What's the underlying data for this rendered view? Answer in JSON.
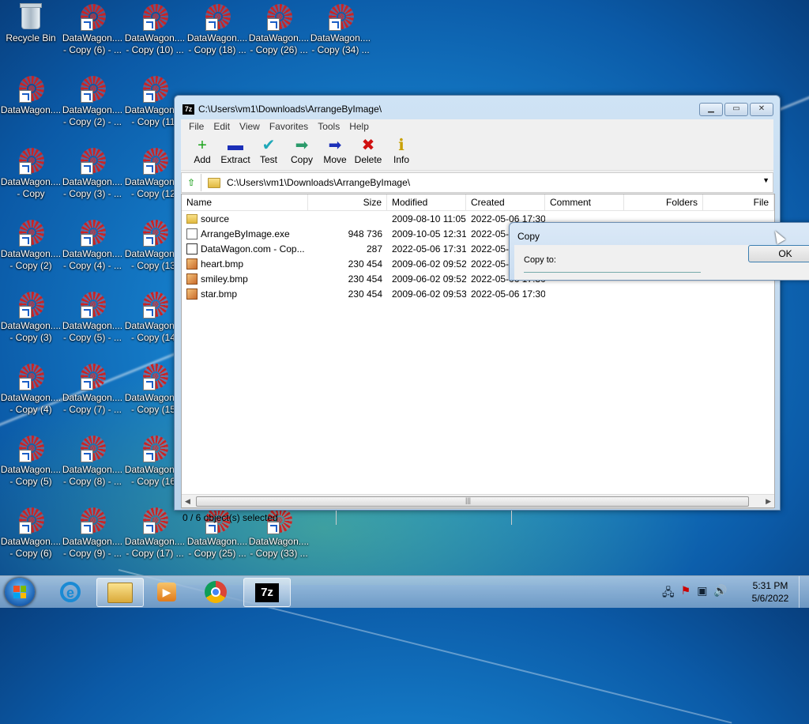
{
  "desktop": {
    "icons": [
      {
        "line1": "Recycle Bin",
        "line2": "",
        "kind": "bin"
      },
      {
        "line1": "DataWagon....",
        "line2": "- Copy (6) - ...",
        "kind": "link"
      },
      {
        "line1": "DataWagon....",
        "line2": "- Copy (10) ...",
        "kind": "link"
      },
      {
        "line1": "DataWagon....",
        "line2": "- Copy (18) ...",
        "kind": "link"
      },
      {
        "line1": "DataWagon....",
        "line2": "- Copy (26) ...",
        "kind": "link"
      },
      {
        "line1": "DataWagon....",
        "line2": "- Copy (34) ...",
        "kind": "link"
      },
      {
        "line1": "DataWagon....",
        "line2": "",
        "kind": "link"
      },
      {
        "line1": "DataWagon....",
        "line2": "- Copy (2) - ...",
        "kind": "link"
      },
      {
        "line1": "DataWagon....",
        "line2": "- Copy (11)",
        "kind": "link"
      },
      {
        "line1": "DataWagon....",
        "line2": "- Copy",
        "kind": "link"
      },
      {
        "line1": "DataWagon....",
        "line2": "- Copy (3) - ...",
        "kind": "link"
      },
      {
        "line1": "DataWagon....",
        "line2": "- Copy (12)",
        "kind": "link"
      },
      {
        "line1": "DataWagon....",
        "line2": "- Copy (2)",
        "kind": "link"
      },
      {
        "line1": "DataWagon....",
        "line2": "- Copy (4) - ...",
        "kind": "link"
      },
      {
        "line1": "DataWagon....",
        "line2": "- Copy (13)",
        "kind": "link"
      },
      {
        "line1": "DataWagon....",
        "line2": "- Copy (3)",
        "kind": "link"
      },
      {
        "line1": "DataWagon....",
        "line2": "- Copy (5) - ...",
        "kind": "link"
      },
      {
        "line1": "DataWagon....",
        "line2": "- Copy (14)",
        "kind": "link"
      },
      {
        "line1": "DataWagon....",
        "line2": "- Copy (4)",
        "kind": "link"
      },
      {
        "line1": "DataWagon....",
        "line2": "- Copy (7) - ...",
        "kind": "link"
      },
      {
        "line1": "DataWagon....",
        "line2": "- Copy (15)",
        "kind": "link"
      },
      {
        "line1": "DataWagon....",
        "line2": "- Copy (5)",
        "kind": "link"
      },
      {
        "line1": "DataWagon....",
        "line2": "- Copy (8) - ...",
        "kind": "link"
      },
      {
        "line1": "DataWagon....",
        "line2": "- Copy (16)",
        "kind": "link"
      },
      {
        "line1": "DataWagon....",
        "line2": "- Copy (6)",
        "kind": "link"
      },
      {
        "line1": "DataWagon....",
        "line2": "- Copy (9) - ...",
        "kind": "link"
      },
      {
        "line1": "DataWagon....",
        "line2": "- Copy (17) ...",
        "kind": "link"
      },
      {
        "line1": "DataWagon....",
        "line2": "- Copy (25) ...",
        "kind": "link"
      },
      {
        "line1": "DataWagon....",
        "line2": "- Copy (33) ...",
        "kind": "link"
      }
    ]
  },
  "window": {
    "title": "C:\\Users\\vm1\\Downloads\\ArrangeByImage\\",
    "app_icon": "7z",
    "menu": [
      "File",
      "Edit",
      "View",
      "Favorites",
      "Tools",
      "Help"
    ],
    "toolbar": [
      {
        "label": "Add",
        "icon": "+",
        "color": "#1aa31a"
      },
      {
        "label": "Extract",
        "icon": "▬",
        "color": "#1b2fb8"
      },
      {
        "label": "Test",
        "icon": "✔",
        "color": "#1fa8b8"
      },
      {
        "label": "Copy",
        "icon": "➡",
        "color": "#2a9a6a"
      },
      {
        "label": "Move",
        "icon": "➡",
        "color": "#1b2fb8"
      },
      {
        "label": "Delete",
        "icon": "✖",
        "color": "#d01010"
      },
      {
        "label": "Info",
        "icon": "ℹ",
        "color": "#c8a000"
      }
    ],
    "address": "C:\\Users\\vm1\\Downloads\\ArrangeByImage\\",
    "columns": [
      "Name",
      "Size",
      "Modified",
      "Created",
      "Comment",
      "Folders",
      "File"
    ],
    "files": [
      {
        "name": "source",
        "size": "",
        "modified": "2009-08-10 11:05",
        "created": "2022-05-06 17:30",
        "icon": "folder"
      },
      {
        "name": "ArrangeByImage.exe",
        "size": "948 736",
        "modified": "2009-10-05 12:31",
        "created": "2022-05-0",
        "icon": "exe"
      },
      {
        "name": "DataWagon.com - Cop...",
        "size": "287",
        "modified": "2022-05-06 17:31",
        "created": "2022-05-0",
        "icon": "lnk"
      },
      {
        "name": "heart.bmp",
        "size": "230 454",
        "modified": "2009-06-02 09:52",
        "created": "2022-05-0",
        "icon": "bmp"
      },
      {
        "name": "smiley.bmp",
        "size": "230 454",
        "modified": "2009-06-02 09:52",
        "created": "2022-05-06 17:30",
        "icon": "bmp"
      },
      {
        "name": "star.bmp",
        "size": "230 454",
        "modified": "2009-06-02 09:53",
        "created": "2022-05-06 17:30",
        "icon": "bmp"
      }
    ],
    "status": "0 / 6 object(s) selected"
  },
  "copy_dialog": {
    "title": "Copy",
    "label": "Copy to:",
    "ok": "OK"
  },
  "taskbar": {
    "time": "5:31 PM",
    "date": "5/6/2022",
    "ie_glyph": "e",
    "media_glyph": "▶",
    "z7_label": "7z",
    "tray_icons": [
      "network-icon",
      "flag-icon",
      "monitor-icon",
      "volume-icon"
    ]
  }
}
